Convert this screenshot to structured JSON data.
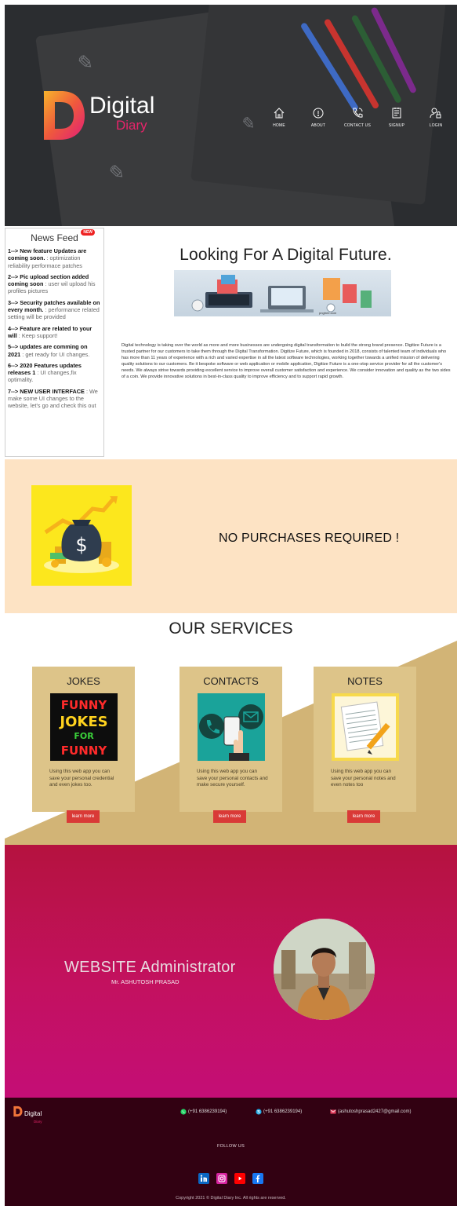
{
  "brand": {
    "word1": "Digital",
    "word2": "Diary",
    "primary_color": "#e8246a",
    "accent_color": "#f6a623"
  },
  "nav": {
    "items": [
      {
        "label": "HOME",
        "icon": "home-icon"
      },
      {
        "label": "ABOUT",
        "icon": "info-icon"
      },
      {
        "label": "CONTACT US",
        "icon": "phone-icon"
      },
      {
        "label": "SIGNUP",
        "icon": "form-icon"
      },
      {
        "label": "LOGIN",
        "icon": "user-key-icon"
      }
    ]
  },
  "news": {
    "title": "News Feed",
    "badge": "NEW",
    "items": [
      {
        "head": "1--> New feature Updates are coming soon.",
        "desc": " : optimization reliability performace patches"
      },
      {
        "head": "2--> Pic upload section added coming soon",
        "desc": " : user wil upload his profiles pictures"
      },
      {
        "head": "3--> Security patches available on every month.",
        "desc": " : performance related setting will be provided"
      },
      {
        "head": "4--> Feature are related to your will",
        "desc": " : Keep support!"
      },
      {
        "head": "5--> updates are comming on 2021",
        "desc": " : get ready for UI changes."
      },
      {
        "head": "6--> 2020 Features updates releases 1",
        "desc": " : UI changes,fix optimality."
      },
      {
        "head": "7--> NEW USER INTERFACE",
        "desc": " : We make some UI changes to the website, let's go and check this out"
      }
    ]
  },
  "about": {
    "title": "Looking For A Digital Future.",
    "image_caption": "pngtree.com",
    "body": "Digital technology is taking over the world as more and more businesses are undergoing digital transformation to build the strong brand presence. Digitize Future is a trusted partner for our customers to take them through the Digital Transformation. Digitize Future, which is founded in 2018, consists of talented team of individuals who has more than 11 years of experience with a rich and varied expertise in all the latest software technologies, working together towards a unified mission of delivering quality solutions to our customers. Be it bespoke software or web application or mobile application, Digitize Future is a one-stop service provider for all the customer's needs. We always strive towards providing excellent service to improve overall customer satisfaction and experience. We consider innovation and quality as the two sides of a coin. We provide innovative solutions in best-in-class quality to improve efficiency and to support rapid growth."
  },
  "promo": {
    "text": "NO PURCHASES REQUIRED !",
    "bg_color": "#fde3c4",
    "image_bg": "#fce71d"
  },
  "services": {
    "title": "OUR SERVICES",
    "cards": [
      {
        "title": "JOKES",
        "img_text": [
          "FUNNY",
          "JOKES",
          "FOR",
          "FUNNY"
        ],
        "desc": "Using this web app you can save your personal credential and even jokes too.",
        "button": "learn more"
      },
      {
        "title": "CONTACTS",
        "desc": "Using this web app you can save your personal contacts and make secure yourself.",
        "button": "learn more"
      },
      {
        "title": "NOTES",
        "desc": "Using this web app you can save your personal notes and even notes too",
        "button": "learn more"
      }
    ],
    "card_color": "#ddc489",
    "band_color": "#d2b476"
  },
  "admin": {
    "title": "WEBSITE Administrator",
    "name": "Mr. ASHUTOSH PRASAD"
  },
  "footer": {
    "logo_word1": "Digital",
    "logo_word2": "Diary",
    "whatsapp": "(+91 6386239194)",
    "phone": "(+91 6386239194)",
    "email": "(ashutoshprasad2427@gmail.com)",
    "follow": "FOLLOW US",
    "socials": [
      "linkedin-icon",
      "instagram-icon",
      "youtube-icon",
      "facebook-icon"
    ],
    "copyright": "Copyright 2021 © Digital Diary Inc. All rights are reserved."
  }
}
